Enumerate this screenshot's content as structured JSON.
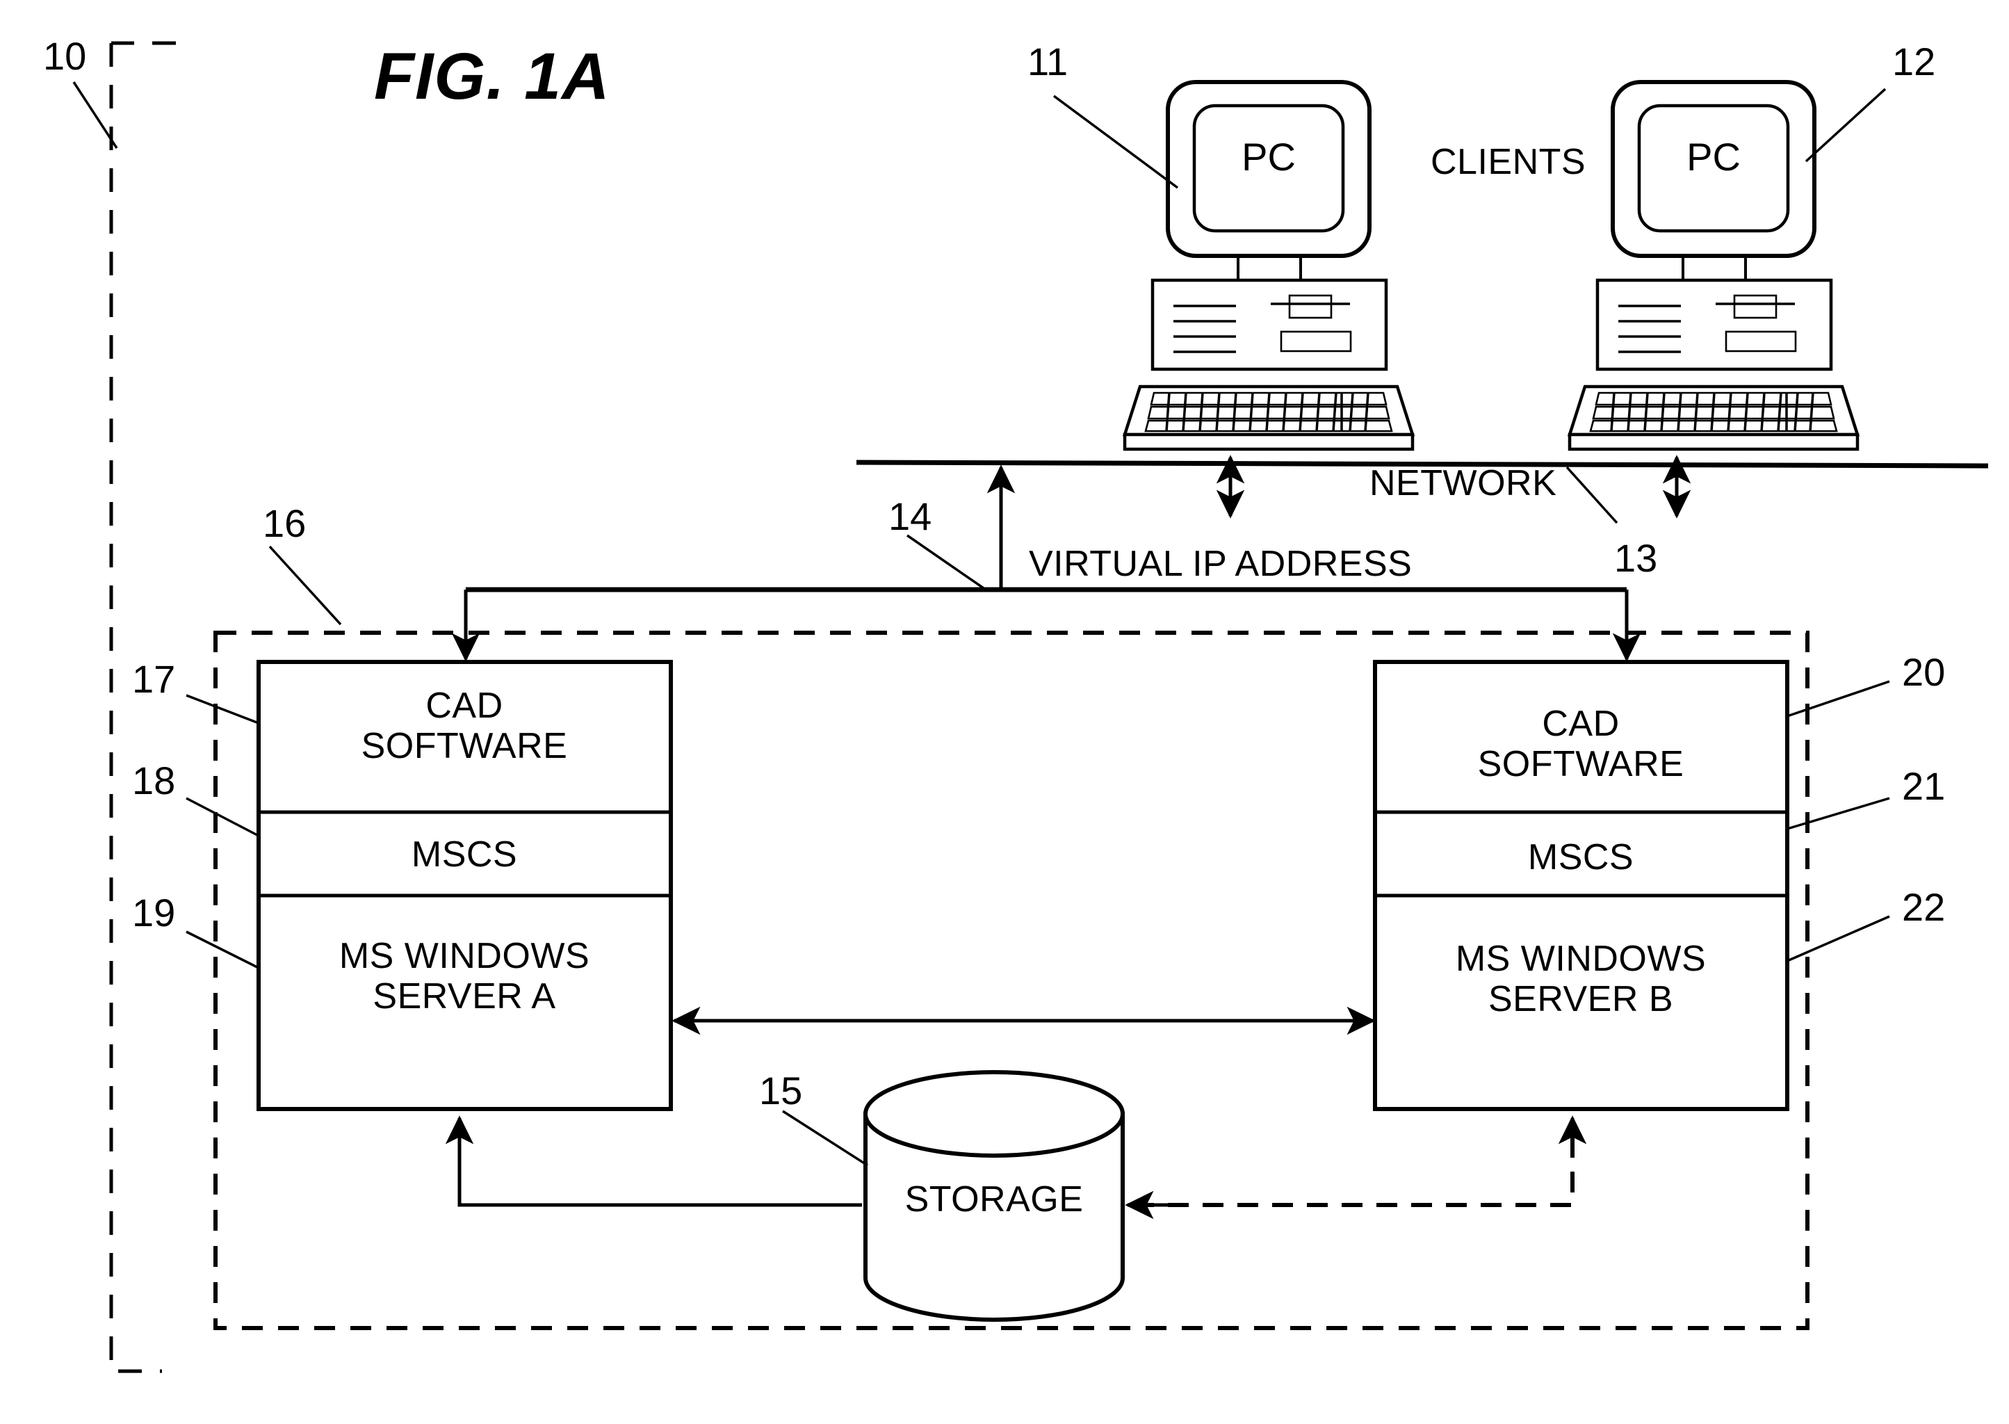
{
  "figure": {
    "title": "FIG. 1A",
    "system_ref": "10"
  },
  "clients": {
    "group_label": "CLIENTS",
    "machines": [
      {
        "label": "PC",
        "ref": "11"
      },
      {
        "label": "PC",
        "ref": "12"
      }
    ]
  },
  "network": {
    "label": "NETWORK",
    "ref": "13"
  },
  "virtual_ip": {
    "label": "VIRTUAL IP ADDRESS",
    "ref": "14"
  },
  "cluster": {
    "ref": "16",
    "servers": [
      {
        "ref_stack": [
          "17",
          "18",
          "19"
        ],
        "layers": [
          {
            "line1": "CAD",
            "line2": "SOFTWARE",
            "ref": "17"
          },
          {
            "line1": "MSCS",
            "line2": "",
            "ref": "18"
          },
          {
            "line1": "MS WINDOWS",
            "line2": "SERVER A",
            "ref": "19"
          }
        ]
      },
      {
        "ref_stack": [
          "20",
          "21",
          "22"
        ],
        "layers": [
          {
            "line1": "CAD",
            "line2": "SOFTWARE",
            "ref": "20"
          },
          {
            "line1": "MSCS",
            "line2": "",
            "ref": "21"
          },
          {
            "line1": "MS WINDOWS",
            "line2": "SERVER B",
            "ref": "22"
          }
        ]
      }
    ]
  },
  "storage": {
    "label": "STORAGE",
    "ref": "15"
  },
  "colors": {
    "ink": "#000000",
    "paper": "#ffffff"
  }
}
